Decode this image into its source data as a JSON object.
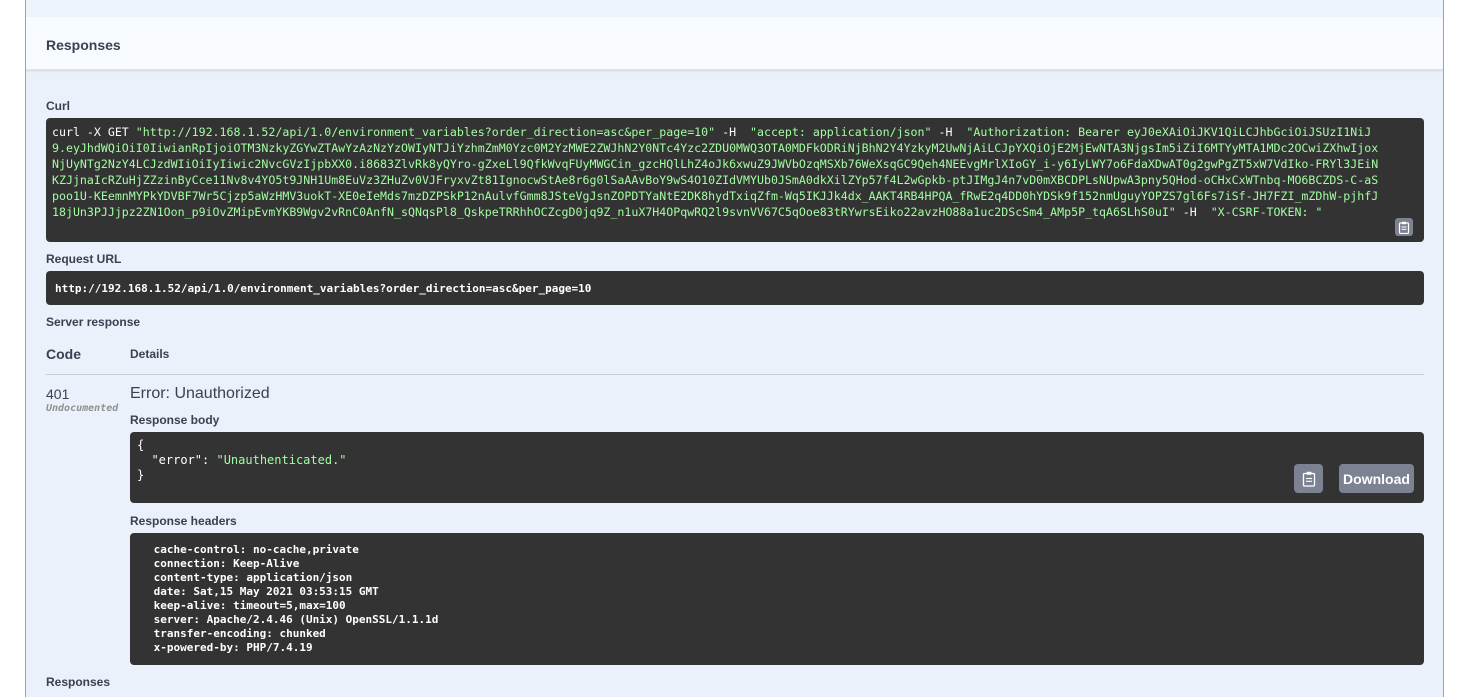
{
  "section": {
    "title": "Responses"
  },
  "curl": {
    "label": "Curl",
    "parts": [
      {
        "text": "curl -X GET ",
        "str": false
      },
      {
        "text": "\"http://192.168.1.52/api/1.0/environment_variables?order_direction=asc&per_page=10\"",
        "str": true
      },
      {
        "text": " -H  ",
        "str": false
      },
      {
        "text": "\"accept: application/json\"",
        "str": true
      },
      {
        "text": " -H  ",
        "str": false
      },
      {
        "text": "\"Authorization: Bearer eyJ0eXAiOiJKV1QiLCJhbGciOiJSUzI1NiJ9.eyJhdWQiOiI0IiwianRpIjoiOTM3NzkyZGYwZTAwYzAzNzYzOWIyNTJiYzhmZmM0Yzc0M2YzMWE2ZWJhN2Y0NTc4Yzc2ZDU0MWQ3OTA0MDFkODRiNjBhN2Y4YzkyM2UwNjAiLCJpYXQiOjE2MjEwNTA3NjgsIm5iZiI6MTYyMTA1MDc2OCwiZXhwIjoxNjUyNTg2NzY4LCJzdWIiOiIyIiwic2NvcGVzIjpbXX0.i8683ZlvRk8yQYro-gZxeLl9QfkWvqFUyMWGCin_gzcHQlLhZ4oJk6xwuZ9JWVbOzqMSXb76WeXsqGC9Qeh4NEEvgMrlXIoGY_i-y6IyLWY7o6FdaXDwAT0g2gwPgZT5xW7VdIko-FRYl3JEiNKZJjnaIcRZuHjZZzinByCce11Nv8v4YO5t9JNH1Um8EuVz3ZHuZv0VJFryxvZt81IgnocwStAe8r6g0lSaAAvBoY9wS4O10ZIdVMYUb0JSmA0dkXilZYp57f4L2wGpkb-ptJIMgJ4n7vD0mXBCDPLsNUpwA3pny5QHod-oCHxCxWTnbq-MO6BCZDS-C-aSpoo1U-KEemnMYPkYDVBF7Wr5Cjzp5aWzHMV3uokT-XE0eIeMds7mzDZPSkP12nAulvfGmm8JSteVgJsnZOPDTYaNtE2DK8hydTxiqZfm-Wq5IKJJk4dx_AAKT4RB4HPQA_fRwE2q4DD0hYDSk9f152nmUguyYOPZS7gl6Fs7iSf-JH7FZI_mZDhW-pjhfJ18jUn3PJJjpz2ZN1Oon_p9iOvZMipEvmYKB9Wgv2vRnC0AnfN_sQNqsPl8_QskpeTRRhhOCZcgD0jq9Z_n1uX7H4OPqwRQ2l9svnVV67C5qOoe83tRYwrsEiko22avzHO88a1uc2DScSm4_AMp5P_tqA6SLhS0uI\"",
        "str": true
      },
      {
        "text": " -H  ",
        "str": false
      },
      {
        "text": "\"X-CSRF-TOKEN: \"",
        "str": true
      }
    ]
  },
  "request_url": {
    "label": "Request URL",
    "value": "http://192.168.1.52/api/1.0/environment_variables?order_direction=asc&per_page=10"
  },
  "server_response": {
    "label": "Server response",
    "code_header": "Code",
    "details_header": "Details",
    "code": "401",
    "undocumented": "Undocumented",
    "error_title": "Error: Unauthorized",
    "body_label": "Response body",
    "body_lines": [
      {
        "prefix": "{",
        "key": "",
        "value": "",
        "suffix": ""
      },
      {
        "prefix": "  ",
        "key": "\"error\"",
        "value": "\"Unauthenticated.\"",
        "suffix": ""
      },
      {
        "prefix": "}",
        "key": "",
        "value": "",
        "suffix": ""
      }
    ],
    "download_label": "Download",
    "headers_label": "Response headers",
    "headers": [
      " cache-control: no-cache,private ",
      " connection: Keep-Alive ",
      " content-type: application/json ",
      " date: Sat,15 May 2021 03:53:15 GMT ",
      " keep-alive: timeout=5,max=100 ",
      " server: Apache/2.4.46 (Unix) OpenSSL/1.1.1d ",
      " transfer-encoding: chunked ",
      " x-powered-by: PHP/7.4.19 "
    ]
  },
  "footer": {
    "label": "Responses"
  },
  "icons": {
    "copy": "clipboard-copy-icon"
  },
  "colors": {
    "accent": "#61affe",
    "panel": "#eaf1fa",
    "code_bg": "#333333",
    "string": "#a2fca2",
    "button": "#7d8293"
  }
}
